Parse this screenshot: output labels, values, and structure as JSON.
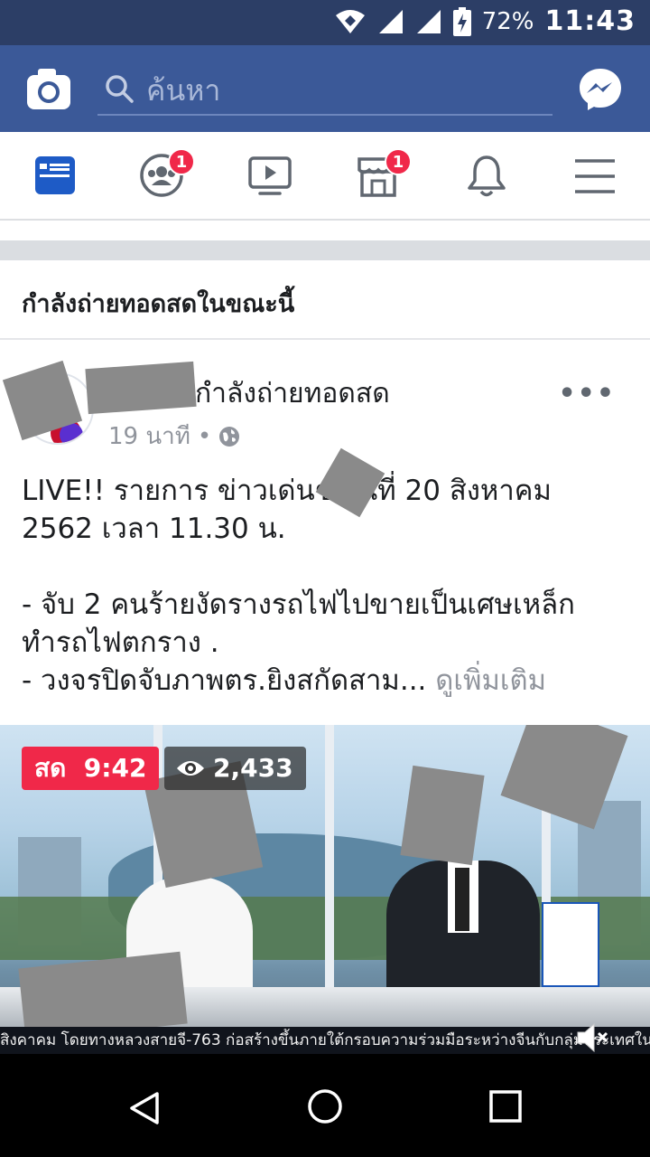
{
  "status_bar": {
    "battery": "72%",
    "time": "11:43",
    "icons": [
      "wifi-icon",
      "signal-icon",
      "signal-icon",
      "battery-charging-icon"
    ]
  },
  "header": {
    "search_placeholder": "ค้นหา",
    "icons": [
      "camera-icon",
      "search-icon",
      "messenger-icon"
    ],
    "brand_color": "#3b5998"
  },
  "nav": {
    "items": [
      {
        "icon": "news-feed-icon",
        "active": true
      },
      {
        "icon": "groups-icon",
        "badge": "1"
      },
      {
        "icon": "watch-icon"
      },
      {
        "icon": "marketplace-icon",
        "badge": "1"
      },
      {
        "icon": "notifications-icon"
      },
      {
        "icon": "menu-icon"
      }
    ]
  },
  "section": {
    "title": "กำลังถ่ายทอดสดในขณะนี้"
  },
  "post": {
    "status": "กำลังถ่ายทอดสด",
    "time_ago": "19 นาที",
    "privacy_icon": "globe-icon",
    "more": "•••",
    "text_lines": [
      "LIVE!! รายการ ข่าวเด่นช          วันที่ 20 สิงหาคม",
      "2562  เวลา 11.30 น.",
      "",
      "- จับ 2 คนร้ายงัดรางรถไฟไปขายเป็นเศษเหล็ก",
      "ทำรถไฟตกราง ."
    ],
    "last_line": "- วงจรปิดจับภาพตร.ยิงสกัดสาม...",
    "see_more": "ดูเพิ่มเติม"
  },
  "video": {
    "live_label": "สด",
    "live_time": "9:42",
    "views": "2,433",
    "ticker": "สิงคาคม โดยทางหลวงสายจี-763 ก่อสร้างขึ้นภายใต้กรอบความร่วมมือระหว่างจีนกับกลุ่มประเทศในยุโรปกลางและยุโรปตะวันออก",
    "live_color": "#f02849"
  }
}
